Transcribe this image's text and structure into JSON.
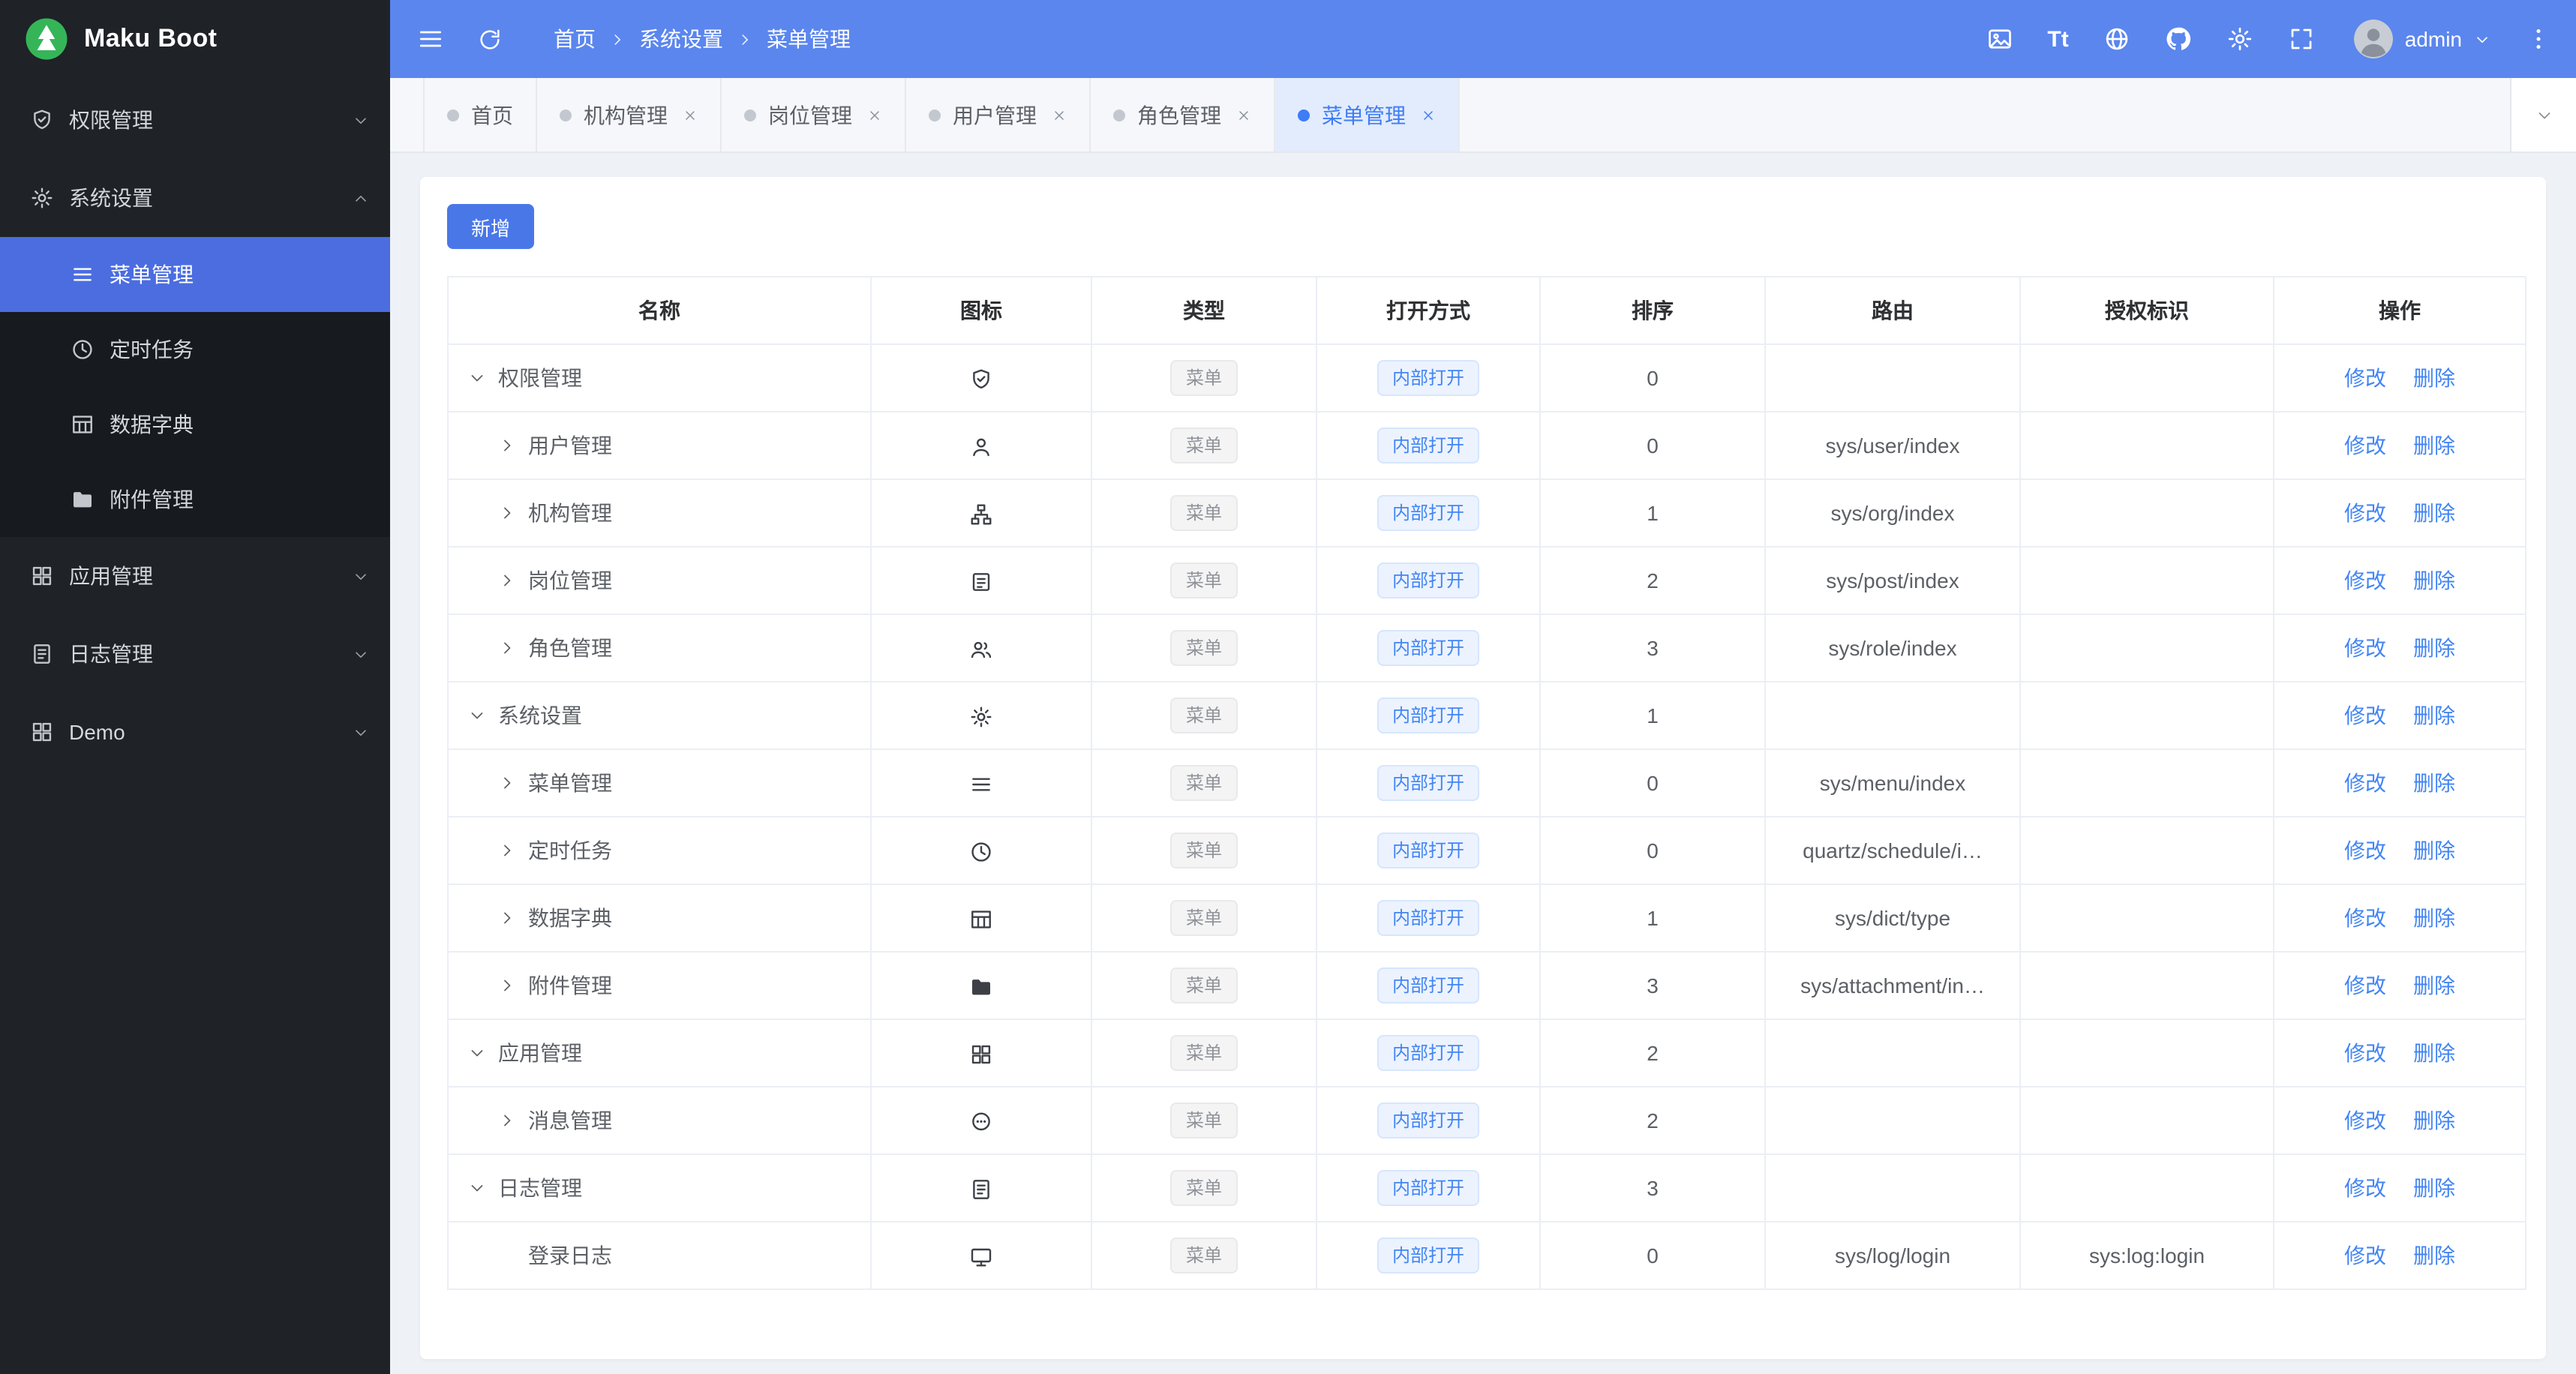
{
  "app": {
    "logo_text": "Maku Boot"
  },
  "header": {
    "breadcrumb": [
      "首页",
      "系统设置",
      "菜单管理"
    ],
    "font_size_label": "Tt",
    "username": "admin"
  },
  "sidebar": {
    "groups": [
      {
        "label": "权限管理"
      },
      {
        "label": "系统设置"
      },
      {
        "label": "应用管理"
      },
      {
        "label": "日志管理"
      },
      {
        "label": "Demo"
      }
    ],
    "system_children": [
      {
        "label": "菜单管理"
      },
      {
        "label": "定时任务"
      },
      {
        "label": "数据字典"
      },
      {
        "label": "附件管理"
      }
    ]
  },
  "tabs": {
    "items": [
      {
        "label": "首页"
      },
      {
        "label": "机构管理"
      },
      {
        "label": "岗位管理"
      },
      {
        "label": "用户管理"
      },
      {
        "label": "角色管理"
      },
      {
        "label": "菜单管理"
      }
    ]
  },
  "toolbar": {
    "add_label": "新增"
  },
  "table": {
    "columns": [
      "名称",
      "图标",
      "类型",
      "打开方式",
      "排序",
      "路由",
      "授权标识",
      "操作"
    ],
    "type_tag": "菜单",
    "open_tag": "内部打开",
    "ops": {
      "edit": "修改",
      "delete": "删除"
    },
    "rows": [
      {
        "name": "权限管理",
        "level": 0,
        "arrow": "down",
        "icon": "shield-icon",
        "sort": "0",
        "route": "",
        "auth": ""
      },
      {
        "name": "用户管理",
        "level": 1,
        "arrow": "right",
        "icon": "user-icon",
        "sort": "0",
        "route": "sys/user/index",
        "auth": ""
      },
      {
        "name": "机构管理",
        "level": 1,
        "arrow": "right",
        "icon": "org-icon",
        "sort": "1",
        "route": "sys/org/index",
        "auth": ""
      },
      {
        "name": "岗位管理",
        "level": 1,
        "arrow": "right",
        "icon": "post-icon",
        "sort": "2",
        "route": "sys/post/index",
        "auth": ""
      },
      {
        "name": "角色管理",
        "level": 1,
        "arrow": "right",
        "icon": "role-icon",
        "sort": "3",
        "route": "sys/role/index",
        "auth": ""
      },
      {
        "name": "系统设置",
        "level": 0,
        "arrow": "down",
        "icon": "gear-icon",
        "sort": "1",
        "route": "",
        "auth": ""
      },
      {
        "name": "菜单管理",
        "level": 1,
        "arrow": "right",
        "icon": "menu-icon",
        "sort": "0",
        "route": "sys/menu/index",
        "auth": ""
      },
      {
        "name": "定时任务",
        "level": 1,
        "arrow": "right",
        "icon": "clock-icon",
        "sort": "0",
        "route": "quartz/schedule/i…",
        "auth": ""
      },
      {
        "name": "数据字典",
        "level": 1,
        "arrow": "right",
        "icon": "dict-icon",
        "sort": "1",
        "route": "sys/dict/type",
        "auth": ""
      },
      {
        "name": "附件管理",
        "level": 1,
        "arrow": "right",
        "icon": "folder-icon",
        "sort": "3",
        "route": "sys/attachment/in…",
        "auth": ""
      },
      {
        "name": "应用管理",
        "level": 0,
        "arrow": "down",
        "icon": "apps-icon",
        "sort": "2",
        "route": "",
        "auth": ""
      },
      {
        "name": "消息管理",
        "level": 1,
        "arrow": "right",
        "icon": "message-icon",
        "sort": "2",
        "route": "",
        "auth": ""
      },
      {
        "name": "日志管理",
        "level": 0,
        "arrow": "down",
        "icon": "log-icon",
        "sort": "3",
        "route": "",
        "auth": ""
      },
      {
        "name": "登录日志",
        "level": 1,
        "arrow": "none",
        "icon": "monitor-icon",
        "sort": "0",
        "route": "sys/log/login",
        "auth": "sys:log:login"
      }
    ]
  },
  "colors": {
    "primary": "#5b86ee",
    "sidebar_bg": "#1f2227",
    "active_item": "#4b6de0",
    "link_blue": "#4285f4",
    "logo_green": "#35b558"
  }
}
